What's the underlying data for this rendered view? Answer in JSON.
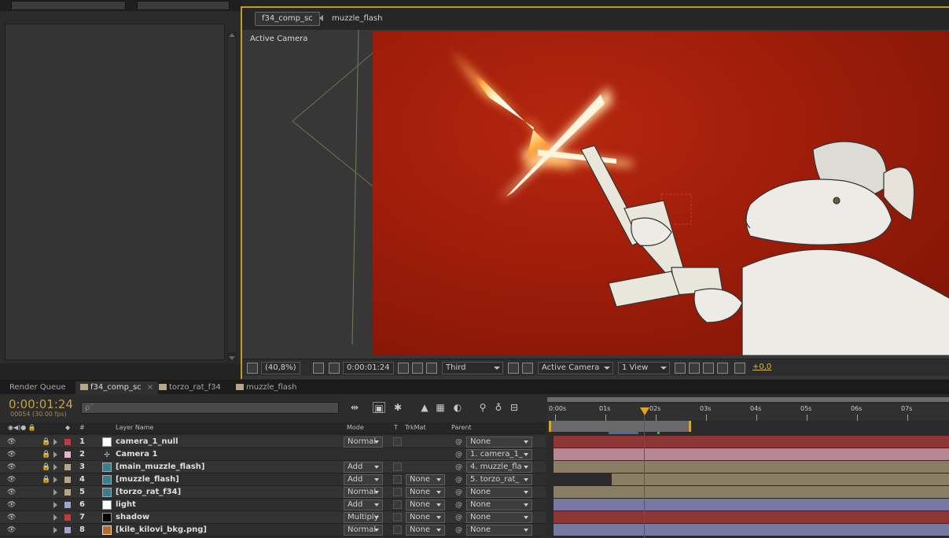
{
  "viewer": {
    "comp_tab": "f34_comp_sc",
    "breadcrumb": "muzzle_flash",
    "camera_label": "Active Camera",
    "toolbar": {
      "zoom": "(40,8%)",
      "timecode": "0:00:01:24",
      "resolution": "Third",
      "view": "Active Camera",
      "layout": "1 View",
      "exposure": "+0,0"
    }
  },
  "timeline": {
    "tabs": [
      {
        "label": "Render Queue",
        "swatch": ""
      },
      {
        "label": "f34_comp_sc",
        "swatch": "#b7a683",
        "closable": "×"
      },
      {
        "label": "torzo_rat_f34",
        "swatch": "#b7a683"
      },
      {
        "label": "muzzle_flash",
        "swatch": "#b7a683"
      }
    ],
    "timecode": "0:00:01:24",
    "frame_info": "00054 (30.00 fps)",
    "search_placeholder": "ρ˜",
    "headers": {
      "number": "#",
      "layer_name": "Layer Name",
      "mode": "Mode",
      "t": "T",
      "trkmat": "TrkMat",
      "parent": "Parent"
    },
    "ruler": [
      "0:00s",
      "01s",
      "02s",
      "03s",
      "04s",
      "05s",
      "06s",
      "07s"
    ],
    "layers": [
      {
        "num": "1",
        "name": "camera_1_null",
        "label_color": "#c23a3a",
        "icon": "solid",
        "mode": "Normal",
        "trkmat": "",
        "parent": "None",
        "bar_color": "#8e3636"
      },
      {
        "num": "2",
        "name": "Camera 1",
        "label_color": "#e7b6c4",
        "icon": "camera",
        "mode": "",
        "trkmat": "",
        "parent": "1. camera_1_",
        "bar_color": "#b78796"
      },
      {
        "num": "3",
        "name": "[main_muzzle_flash]",
        "label_color": "#b7a683",
        "icon": "comp",
        "mode": "Add",
        "trkmat": "",
        "parent": "4. muzzle_fla",
        "bar_color": "#8a7f66"
      },
      {
        "num": "4",
        "name": "[muzzle_flash]",
        "label_color": "#b7a683",
        "icon": "comp",
        "mode": "Add",
        "trkmat": "None",
        "parent": "5. torzo_rat_",
        "bar_color": "#8a7f66"
      },
      {
        "num": "5",
        "name": "[torzo_rat_f34]",
        "label_color": "#b7a683",
        "icon": "comp",
        "mode": "Normal",
        "trkmat": "None",
        "parent": "None",
        "bar_color": "#8a7f66"
      },
      {
        "num": "6",
        "name": "light",
        "label_color": "#a3a4cc",
        "icon": "solid",
        "mode": "Add",
        "trkmat": "None",
        "parent": "None",
        "bar_color": "#7779a2"
      },
      {
        "num": "7",
        "name": "shadow",
        "label_color": "#c23a3a",
        "icon": "black",
        "mode": "Multiply",
        "trkmat": "None",
        "parent": "None",
        "bar_color": "#8e3636"
      },
      {
        "num": "8",
        "name": "[kile_kilovi_bkg.png]",
        "label_color": "#a3a4cc",
        "icon": "image",
        "mode": "Normal",
        "trkmat": "None",
        "parent": "None",
        "bar_color": "#7779a2"
      }
    ]
  },
  "colors": {
    "accent": "#c79a28",
    "timecode": "#c7a13a",
    "cti": "#e0201b",
    "canvas_bg": "#9e1d0a"
  }
}
